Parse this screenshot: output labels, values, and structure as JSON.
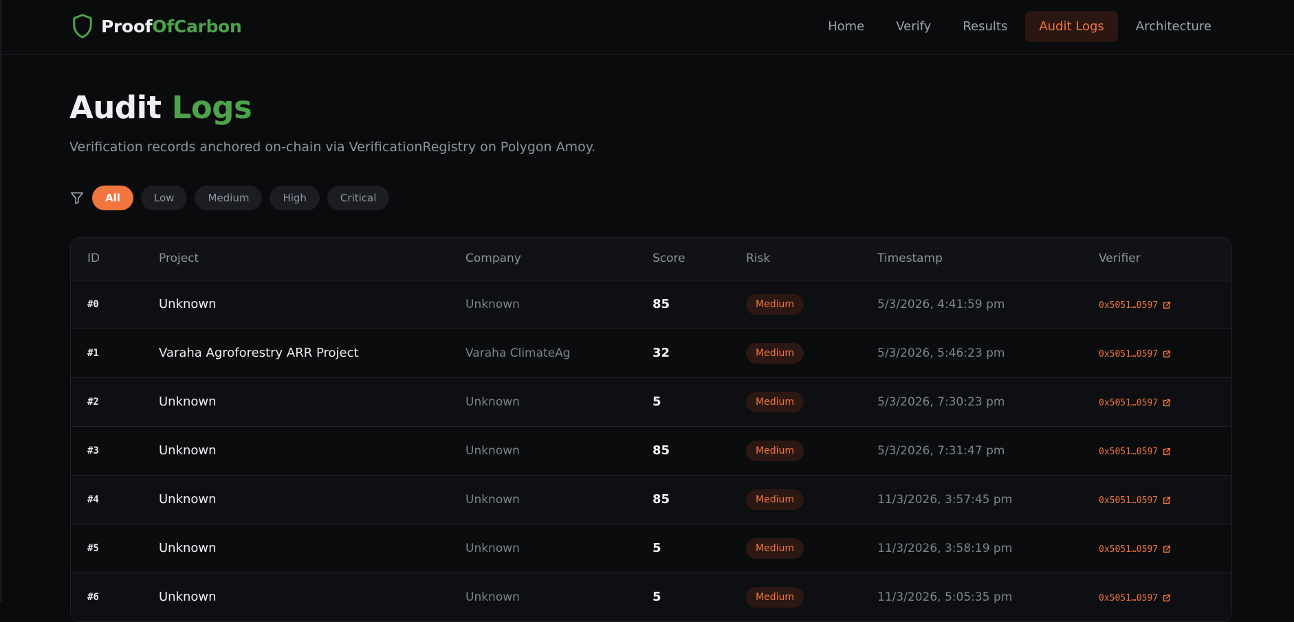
{
  "brand": {
    "name_part1": "Proof",
    "name_part2": "OfCarbon",
    "icon": "shield-icon"
  },
  "nav": {
    "items": [
      {
        "label": "Home",
        "active": false
      },
      {
        "label": "Verify",
        "active": false
      },
      {
        "label": "Results",
        "active": false
      },
      {
        "label": "Audit Logs",
        "active": true
      },
      {
        "label": "Architecture",
        "active": false
      }
    ]
  },
  "page": {
    "title_part1": "Audit",
    "title_part2": "Logs",
    "subtitle": "Verification records anchored on-chain via VerificationRegistry on Polygon Amoy."
  },
  "filters": {
    "icon": "filter-icon",
    "options": [
      "All",
      "Low",
      "Medium",
      "High",
      "Critical"
    ],
    "selected": "All"
  },
  "table": {
    "columns": [
      "ID",
      "Project",
      "Company",
      "Score",
      "Risk",
      "Timestamp",
      "Verifier"
    ],
    "rows": [
      {
        "id": "#0",
        "project": "Unknown",
        "company": "Unknown",
        "score": "85",
        "risk": "Medium",
        "timestamp": "5/3/2026, 4:41:59 pm",
        "verifier": "0x5051…0597"
      },
      {
        "id": "#1",
        "project": "Varaha Agroforestry ARR Project",
        "company": "Varaha ClimateAg",
        "score": "32",
        "risk": "Medium",
        "timestamp": "5/3/2026, 5:46:23 pm",
        "verifier": "0x5051…0597"
      },
      {
        "id": "#2",
        "project": "Unknown",
        "company": "Unknown",
        "score": "5",
        "risk": "Medium",
        "timestamp": "5/3/2026, 7:30:23 pm",
        "verifier": "0x5051…0597"
      },
      {
        "id": "#3",
        "project": "Unknown",
        "company": "Unknown",
        "score": "85",
        "risk": "Medium",
        "timestamp": "5/3/2026, 7:31:47 pm",
        "verifier": "0x5051…0597"
      },
      {
        "id": "#4",
        "project": "Unknown",
        "company": "Unknown",
        "score": "85",
        "risk": "Medium",
        "timestamp": "11/3/2026, 3:57:45 pm",
        "verifier": "0x5051…0597"
      },
      {
        "id": "#5",
        "project": "Unknown",
        "company": "Unknown",
        "score": "5",
        "risk": "Medium",
        "timestamp": "11/3/2026, 3:58:19 pm",
        "verifier": "0x5051…0597"
      },
      {
        "id": "#6",
        "project": "Unknown",
        "company": "Unknown",
        "score": "5",
        "risk": "Medium",
        "timestamp": "11/3/2026, 5:05:35 pm",
        "verifier": "0x5051…0597"
      }
    ]
  },
  "colors": {
    "accent": "#f0753f",
    "brand_green": "#4ea34a",
    "background": "#0a0b0d"
  }
}
